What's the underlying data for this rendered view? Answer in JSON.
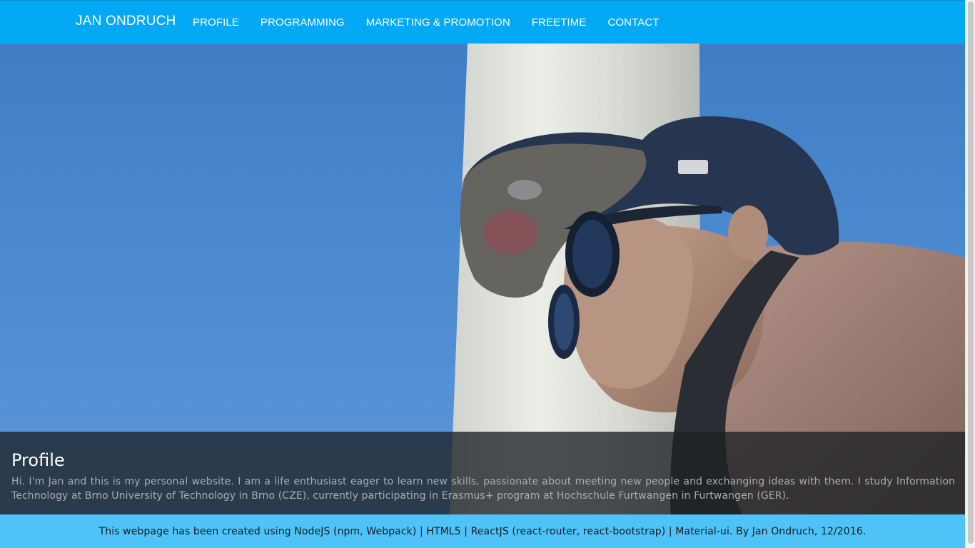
{
  "nav": {
    "brand": "JAN ONDRUCH",
    "links": [
      "PROFILE",
      "PROGRAMMING",
      "MARKETING & PROMOTION",
      "FREETIME",
      "CONTACT"
    ]
  },
  "hero": {
    "image": "profile-photo",
    "caption_title": "Profile",
    "caption_text": "Hi. I'm Jan and this is my personal website. I am a life enthusiast eager to learn new skills, passionate about meeting new people and exchanging ideas with them. I study Information Technology at Brno University of Technology in Brno (CZE), currently participating in Erasmus+ program at Hochschule Furtwangen in Furtwangen (GER)."
  },
  "footer": {
    "text": "This webpage has been created using NodeJS (npm, Webpack) | HTML5 | ReactJS (react-router, react-bootstrap) | Material-ui. By Jan Ondruch, 12/2016."
  },
  "colors": {
    "navbar": "#03a9f4",
    "footer": "#4fc3f7",
    "caption_bg": "#1e2126"
  }
}
